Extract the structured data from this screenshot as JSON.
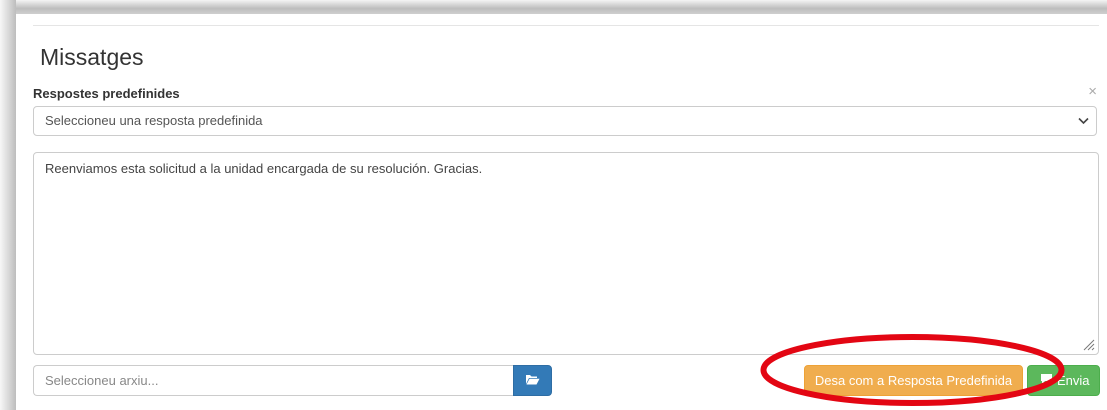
{
  "page": {
    "title": "Missatges"
  },
  "predefined": {
    "label": "Respostes predefinides",
    "close_symbol": "×",
    "select_value": "Seleccioneu una resposta predefinida"
  },
  "message": {
    "text": "Reenviamos esta solicitud a la unidad encargada de su resolución. Gracias."
  },
  "attachment": {
    "placeholder": "Seleccioneu arxiu..."
  },
  "actions": {
    "save_predefined_label": "Desa com a Resposta Predefinida",
    "send_label": "Envia"
  },
  "annotation": {
    "highlight_color": "#e30613"
  },
  "icons": {
    "select_chevron": "chevron-down-icon",
    "folder": "folder-open-icon",
    "send": "comment-icon",
    "resize": "resize-grip-icon"
  },
  "colors": {
    "primary": "#337ab7",
    "warning": "#f0ad4e",
    "success": "#5cb85c"
  }
}
